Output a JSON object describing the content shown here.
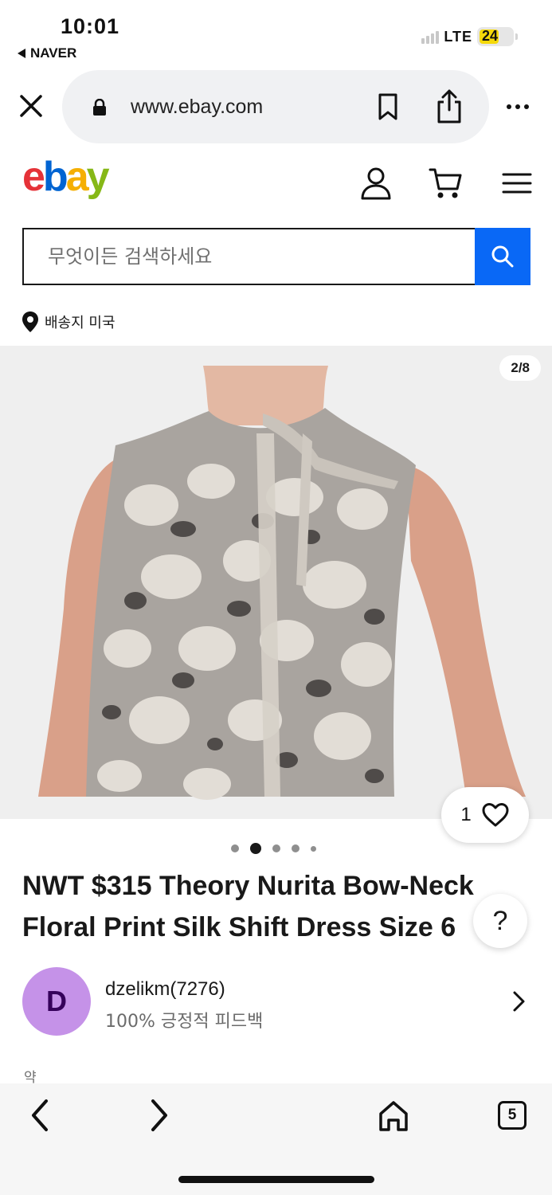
{
  "status": {
    "time": "10:01",
    "back_app": "NAVER",
    "network": "LTE",
    "battery": "24",
    "battery_color": "#f5d90a"
  },
  "browser": {
    "url": "www.ebay.com",
    "icons": [
      "close-icon",
      "lock-icon",
      "bookmark-icon",
      "share-icon",
      "more-icon"
    ]
  },
  "header": {
    "logo": {
      "e": "e",
      "b": "b",
      "a": "a",
      "y": "y"
    },
    "logo_colors": [
      "#e53238",
      "#0064d2",
      "#f5af02",
      "#86b817"
    ],
    "icons": [
      "user-icon",
      "cart-icon",
      "menu-icon"
    ]
  },
  "search": {
    "placeholder": "무엇이든 검색하세요",
    "button_color": "#0968f6"
  },
  "shipping": {
    "label": "배송지 미국"
  },
  "gallery": {
    "counter": "2/8",
    "current_index": 2,
    "total_dots": 5,
    "likes": "1"
  },
  "listing": {
    "title_line1": "NWT $315 Theory Nurita Bow-Neck",
    "title_line2": "Floral Print Silk Shift Dress Size 6",
    "help": "?"
  },
  "seller": {
    "initial": "D",
    "name": "dzelikm(7276)",
    "feedback": "100% 긍정적 피드백",
    "avatar_color": "#c592e8"
  },
  "price_hint": "약",
  "toolbar": {
    "tabs_count": "5"
  }
}
